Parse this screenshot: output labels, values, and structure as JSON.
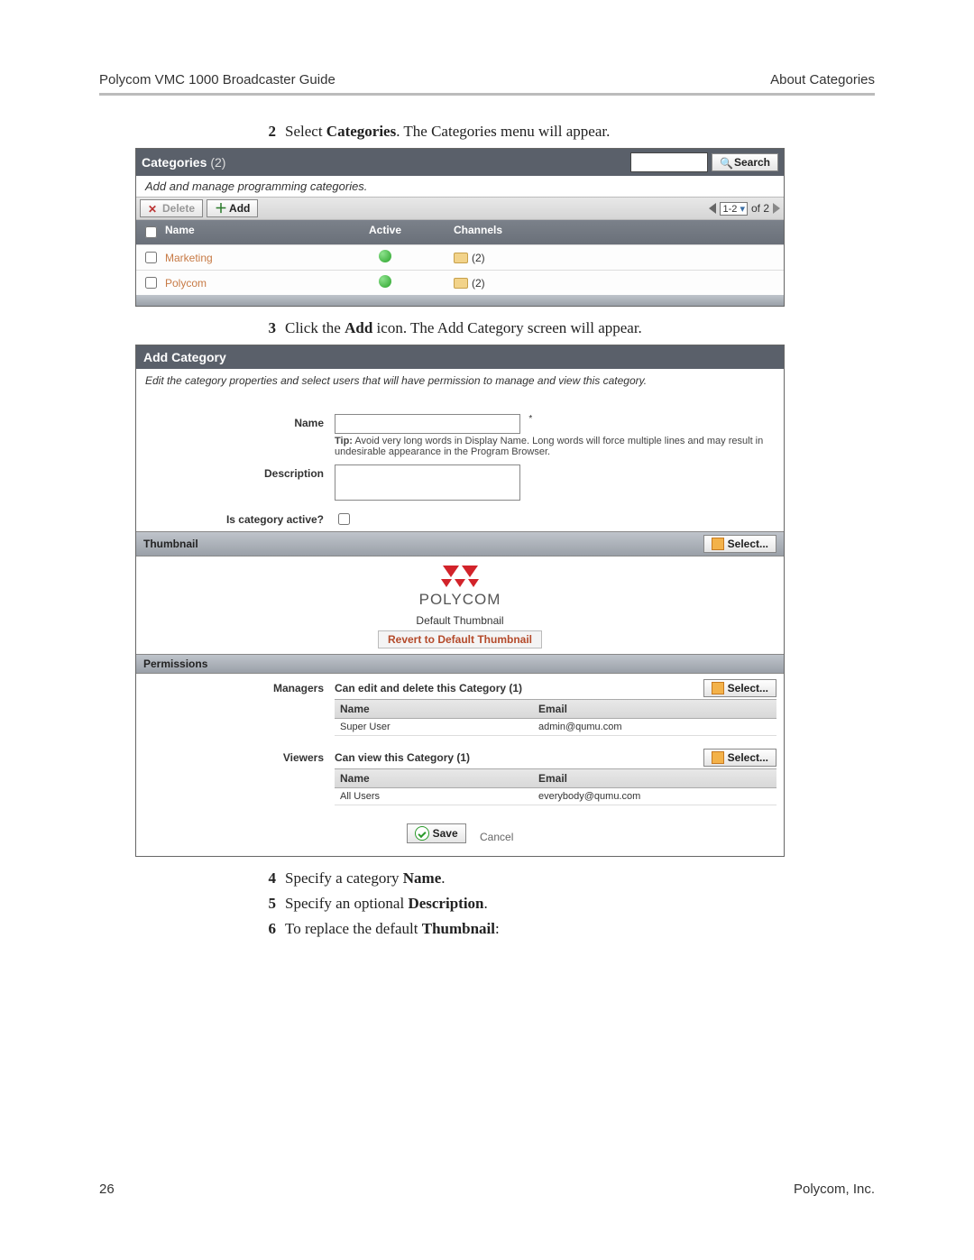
{
  "header": {
    "left": "Polycom VMC 1000 Broadcaster Guide",
    "right": "About Categories"
  },
  "footer": {
    "page_number": "26",
    "company": "Polycom, Inc."
  },
  "steps": {
    "s2": {
      "num": "2",
      "pre": "Select ",
      "bold": "Categories",
      "post": ". The Categories menu will appear."
    },
    "s3": {
      "num": "3",
      "pre": "Click the ",
      "bold": "Add",
      "post": " icon. The Add Category screen will appear."
    },
    "s4": {
      "num": "4",
      "pre": "Specify a category ",
      "bold": "Name",
      "post": "."
    },
    "s5": {
      "num": "5",
      "pre": "Specify an optional ",
      "bold": "Description",
      "post": "."
    },
    "s6": {
      "num": "6",
      "pre": "To replace the default ",
      "bold": "Thumbnail",
      "post": ":"
    }
  },
  "categories_panel": {
    "title": "Categories",
    "count": "(2)",
    "search_btn": "Search",
    "subtitle": "Add and manage programming categories.",
    "delete_btn": "Delete",
    "add_btn": "Add",
    "pager": {
      "range": "1-2",
      "of_label": "of 2"
    },
    "columns": {
      "name": "Name",
      "active": "Active",
      "channels": "Channels"
    },
    "rows": [
      {
        "name": "Marketing",
        "channels": "(2)"
      },
      {
        "name": "Polycom",
        "channels": "(2)"
      }
    ]
  },
  "add_category": {
    "title": "Add Category",
    "subtitle": "Edit the category properties and select users that will have permission to manage and view this category.",
    "labels": {
      "name": "Name",
      "description": "Description",
      "is_active": "Is category active?"
    },
    "tip_bold": "Tip:",
    "tip_text": " Avoid very long words in Display Name. Long words will force multiple lines and may result in undesirable appearance in the Program Browser.",
    "required_marker": "*",
    "thumbnail": {
      "bar_label": "Thumbnail",
      "select_btn": "Select...",
      "brand": "POLYCOM",
      "default_label": "Default Thumbnail",
      "revert_label": "Revert to Default Thumbnail"
    },
    "permissions": {
      "bar_label": "Permissions",
      "managers_label": "Managers",
      "managers_caption": "Can edit and delete this Category  (1)",
      "viewers_label": "Viewers",
      "viewers_caption": "Can view this Category  (1)",
      "select_btn": "Select...",
      "columns": {
        "name": "Name",
        "email": "Email"
      },
      "managers_rows": [
        {
          "name": "Super User",
          "email": "admin@qumu.com"
        }
      ],
      "viewers_rows": [
        {
          "name": "All Users",
          "email": "everybody@qumu.com"
        }
      ]
    },
    "save_btn": "Save",
    "cancel_link": "Cancel"
  }
}
